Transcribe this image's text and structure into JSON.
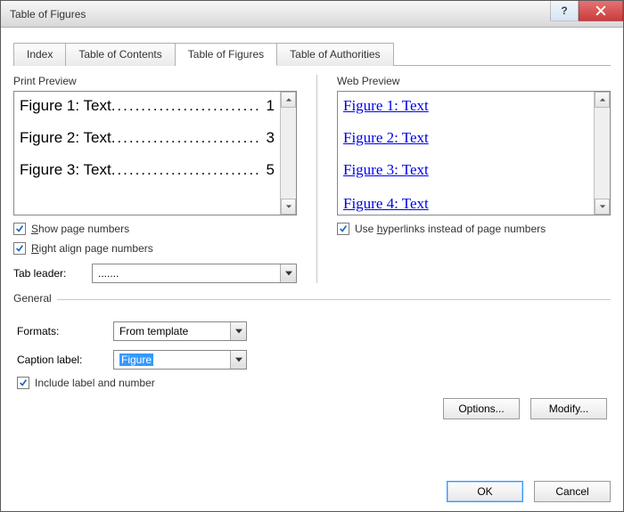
{
  "title": "Table of Figures",
  "tabs": {
    "index": "Index",
    "toc": "Table of Contents",
    "tof": "Table of Figures",
    "toa": "Table of Authorities"
  },
  "print_preview": {
    "label": "Print Preview",
    "rows": [
      {
        "label": "Figure 1: Text",
        "page": "1"
      },
      {
        "label": "Figure 2: Text",
        "page": "3"
      },
      {
        "label": "Figure 3: Text",
        "page": "5"
      }
    ],
    "show_page_numbers_pre": "S",
    "show_page_numbers_post": "how page numbers",
    "right_align_pre": "R",
    "right_align_post": "ight align page numbers",
    "tab_leader_label": "Tab leader:",
    "tab_leader_value": "......."
  },
  "web_preview": {
    "label": "Web Preview",
    "rows": [
      "Figure 1: Text",
      "Figure 2: Text",
      "Figure 3: Text",
      "Figure 4: Text"
    ],
    "use_hyperlinks_pre": "Use ",
    "use_hyperlinks_u": "h",
    "use_hyperlinks_post": "yperlinks instead of page numbers"
  },
  "general": {
    "label": "General",
    "formats_label": "Formats:",
    "formats_value": "From template",
    "caption_label": "Caption label:",
    "caption_value": "Figure",
    "include_label": "Include label and number"
  },
  "buttons": {
    "options": "Options...",
    "modify": "Modify...",
    "ok": "OK",
    "cancel": "Cancel",
    "help": "?"
  }
}
